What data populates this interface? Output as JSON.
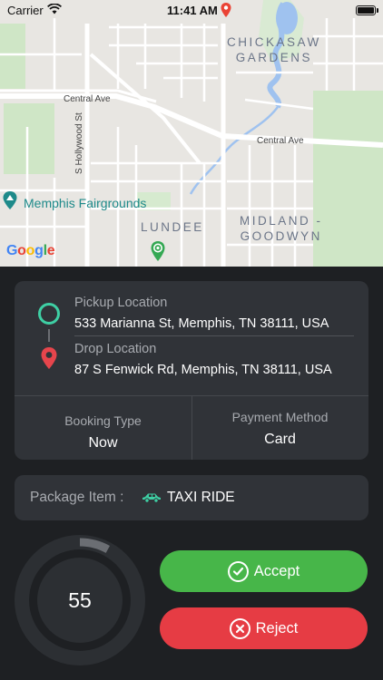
{
  "status_bar": {
    "carrier": "Carrier",
    "time": "11:41 AM"
  },
  "map": {
    "labels": {
      "chickasaw": "CHICKASAW\nGARDENS",
      "central_ave_1": "Central Ave",
      "central_ave_2": "Central Ave",
      "hollywood": "S Hollywood St",
      "fairgrounds": "Memphis Fairgrounds",
      "lundee": "LUNDEE",
      "midland": "MIDLAND -\nGOODWYN"
    },
    "attribution": [
      "G",
      "o",
      "o",
      "g",
      "l",
      "e"
    ]
  },
  "trip": {
    "pickup_label": "Pickup Location",
    "pickup_address": "533 Marianna St, Memphis, TN 38111, USA",
    "drop_label": "Drop Location",
    "drop_address": "87 S Fenwick Rd, Memphis, TN 38111, USA",
    "booking_type_label": "Booking Type",
    "booking_type_value": "Now",
    "payment_method_label": "Payment Method",
    "payment_method_value": "Card"
  },
  "package": {
    "label": "Package Item :",
    "icon": "car-icon",
    "value": "TAXI RIDE"
  },
  "timer": {
    "seconds": "55",
    "progress_fraction": 0.08
  },
  "actions": {
    "accept_label": "Accept",
    "reject_label": "Reject"
  },
  "colors": {
    "pickup_ring": "#3ecfa4",
    "drop_pin": "#e6454c",
    "accept": "#47b649",
    "reject": "#e63c44",
    "card_bg": "#303338",
    "panel_bg": "#1e2023"
  }
}
